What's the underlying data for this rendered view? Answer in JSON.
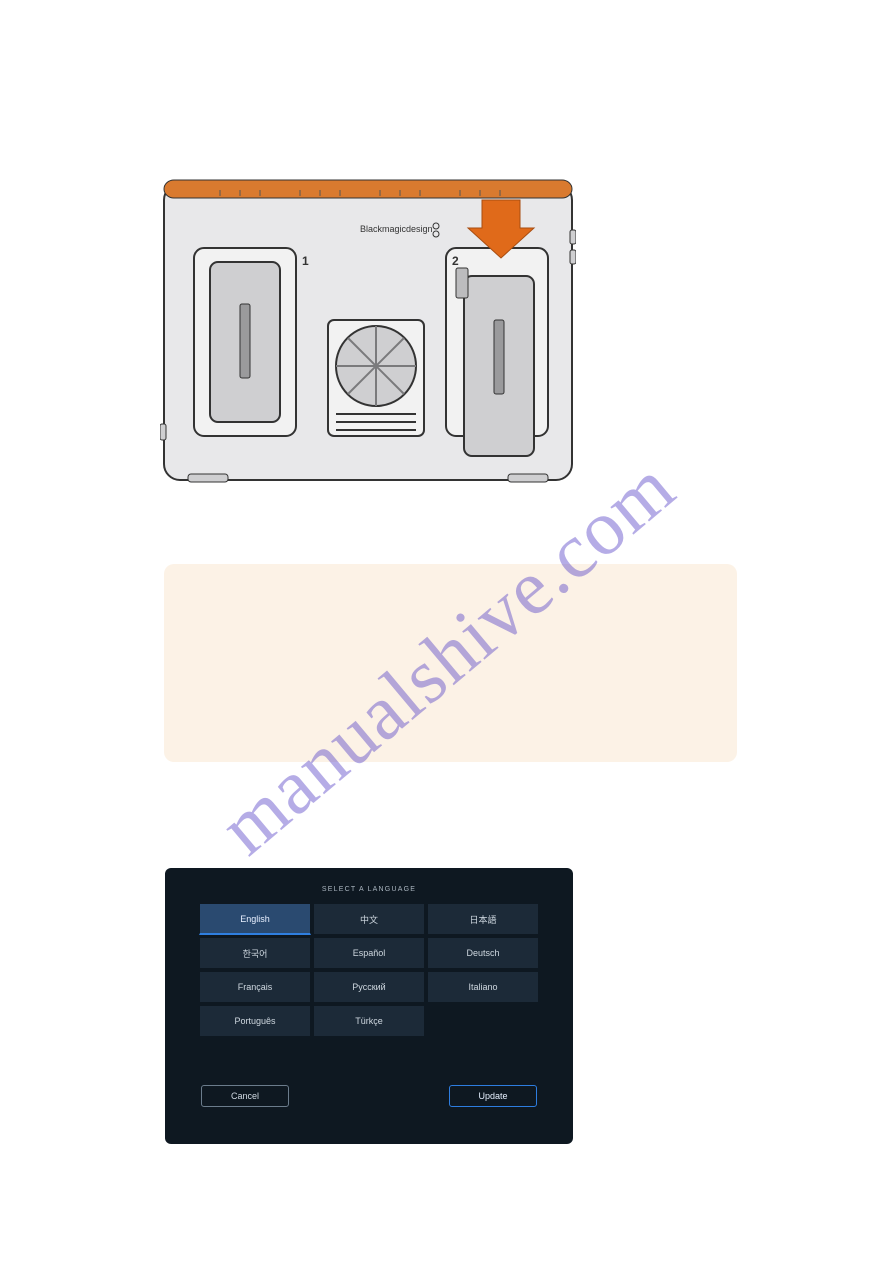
{
  "watermark": "manualshive.com",
  "diagram": {
    "brand_label": "Blackmagicdesign",
    "slot1_label": "1",
    "slot2_label": "2"
  },
  "lang_panel": {
    "title": "SELECT A LANGUAGE",
    "items": [
      {
        "label": "English",
        "selected": true
      },
      {
        "label": "中文",
        "selected": false
      },
      {
        "label": "日本語",
        "selected": false
      },
      {
        "label": "한국어",
        "selected": false
      },
      {
        "label": "Español",
        "selected": false
      },
      {
        "label": "Deutsch",
        "selected": false
      },
      {
        "label": "Français",
        "selected": false
      },
      {
        "label": "Русский",
        "selected": false
      },
      {
        "label": "Italiano",
        "selected": false
      },
      {
        "label": "Português",
        "selected": false
      },
      {
        "label": "Türkçe",
        "selected": false
      }
    ],
    "cancel": "Cancel",
    "update": "Update"
  }
}
